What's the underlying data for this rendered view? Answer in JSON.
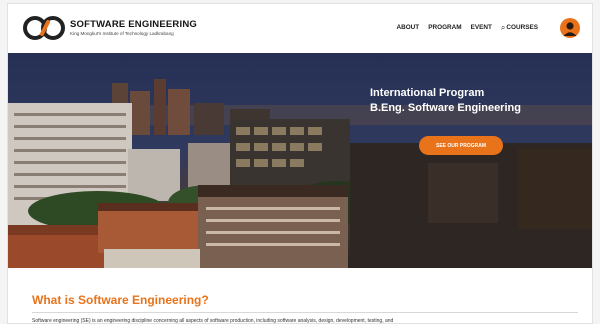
{
  "brand": {
    "title": "SOFTWARE ENGINEERING",
    "subtitle": "King Mongkut's Institute of Technology Ladkrabang"
  },
  "nav": {
    "items": [
      {
        "label": "ABOUT"
      },
      {
        "label": "PROGRAM"
      },
      {
        "label": "EVENT"
      },
      {
        "label": "COURSES"
      }
    ]
  },
  "hero": {
    "title_line1": "International Program",
    "title_line2": "B.Eng. Software Engineering",
    "cta_label": "SEE OUR PROGRAM"
  },
  "section": {
    "title": "What is Software Engineering?",
    "body": "Software engineering (SE) is an engineering discipline concerning all aspects of software production, including software analysis, design, development, testing, and"
  },
  "colors": {
    "accent": "#e8731a",
    "hero_sky": "#1e2640",
    "text": "#222222"
  },
  "icons": {
    "logo": "se-infinity-logo",
    "search": "search-icon",
    "avatar": "user-avatar"
  }
}
